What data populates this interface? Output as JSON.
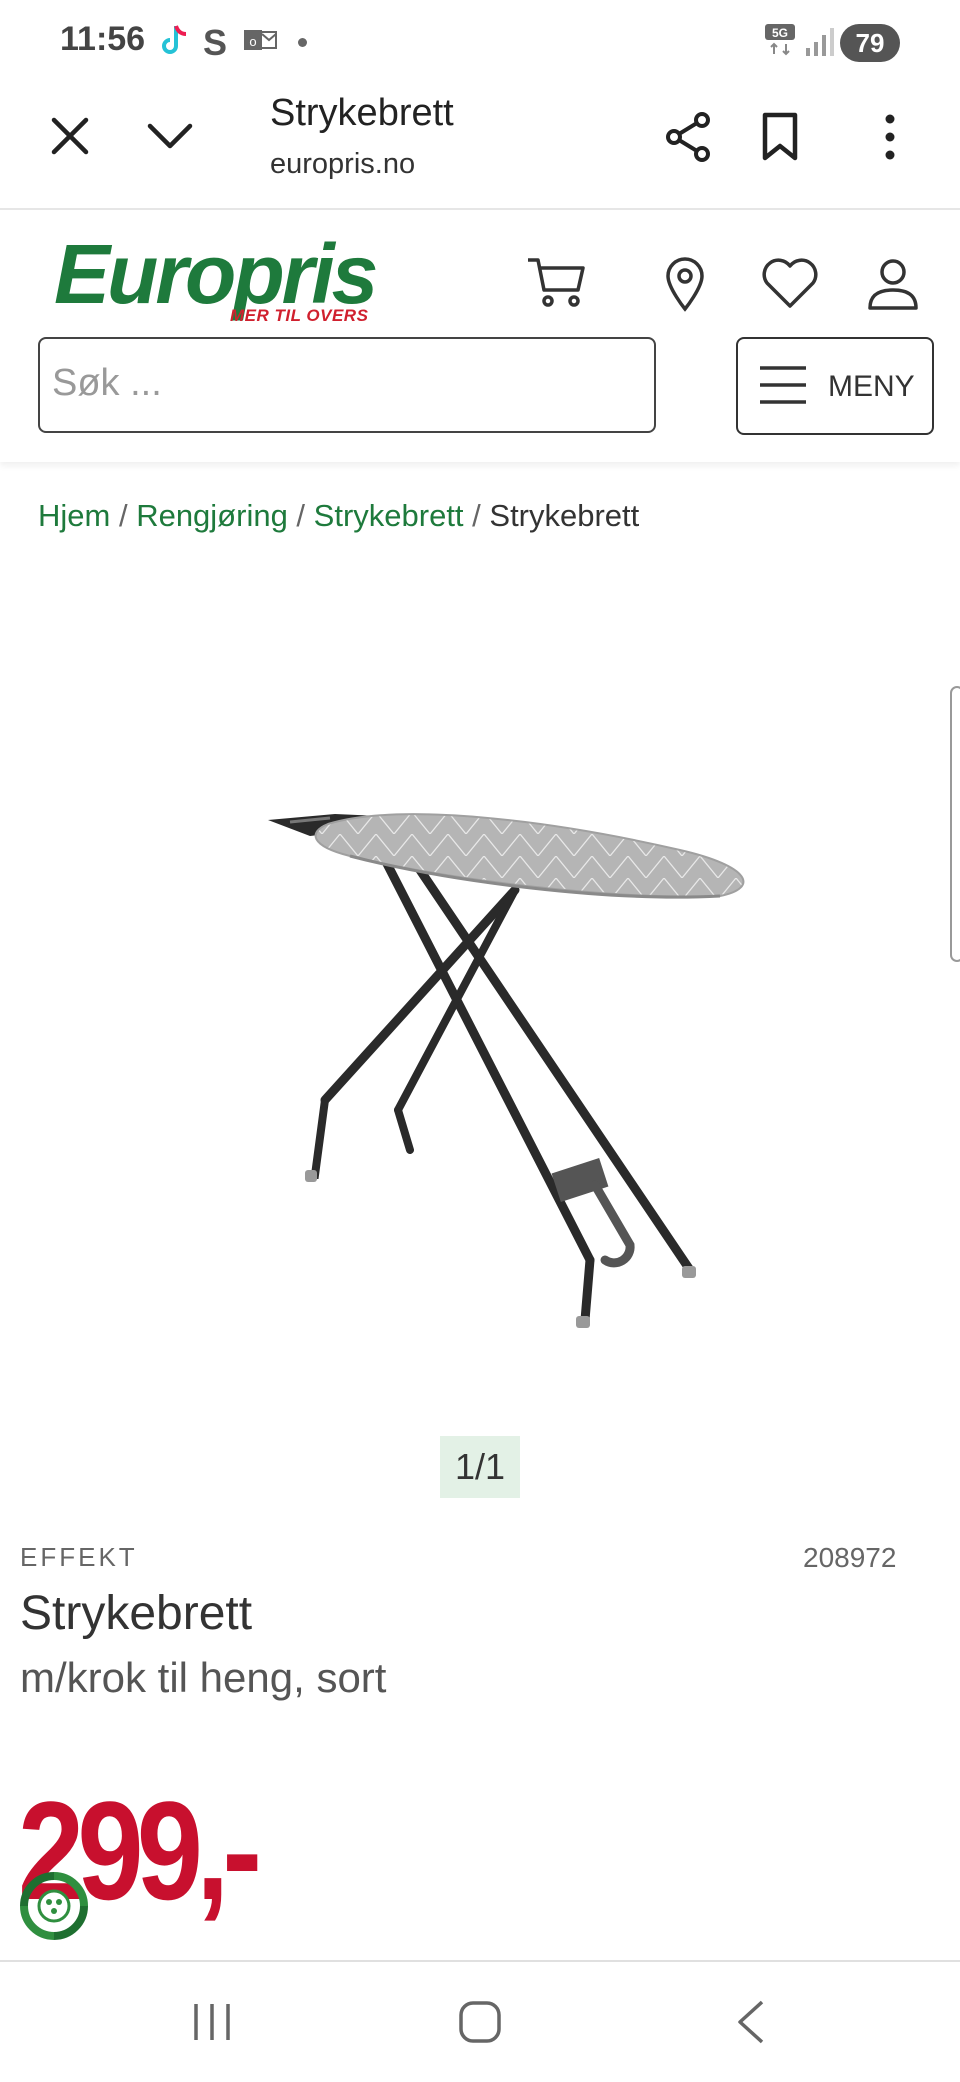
{
  "status_bar": {
    "time": "11:56",
    "network": "5G",
    "battery": "79"
  },
  "browser": {
    "title": "Strykebrett",
    "domain": "europris.no"
  },
  "site": {
    "logo_text": "Europris",
    "logo_tagline": "MER TIL OVERS",
    "search_placeholder": "Søk ...",
    "menu_label": "MENY"
  },
  "breadcrumb": {
    "items": [
      "Hjem",
      "Rengjøring",
      "Strykebrett"
    ],
    "current": "Strykebrett",
    "separator": " / "
  },
  "gallery": {
    "counter": "1/1"
  },
  "product": {
    "brand": "EFFEKT",
    "sku": "208972",
    "name": "Strykebrett",
    "subtitle": "m/krok til heng, sort",
    "price": "299,-"
  },
  "colors": {
    "brand_green": "#1e7a3c",
    "price_red": "#c8102e"
  }
}
